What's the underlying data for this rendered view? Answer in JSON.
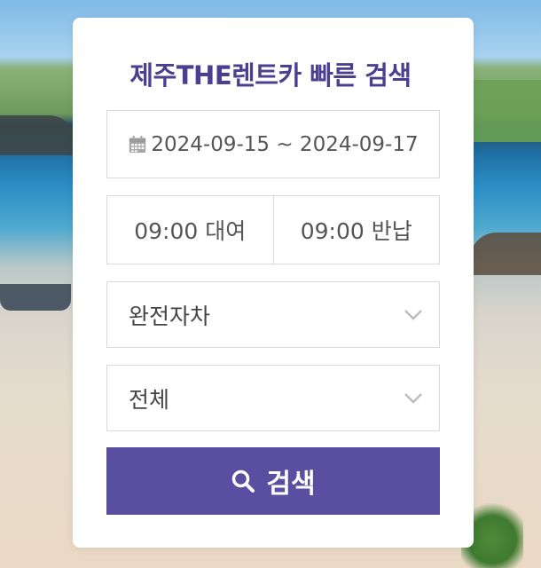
{
  "title": "제주THE렌트카 빠른 검색",
  "date_range": "2024-09-15 ~ 2024-09-17",
  "rental_time": "09:00 대여",
  "return_time": "09:00 반납",
  "car_type_select": {
    "value": "완전자차"
  },
  "category_select": {
    "value": "전체"
  },
  "search_button": {
    "label": "검색"
  },
  "colors": {
    "accent": "#5a4ea0",
    "title": "#4b3f8f"
  },
  "icons": [
    "calendar-icon",
    "chevron-down-icon",
    "search-icon"
  ]
}
